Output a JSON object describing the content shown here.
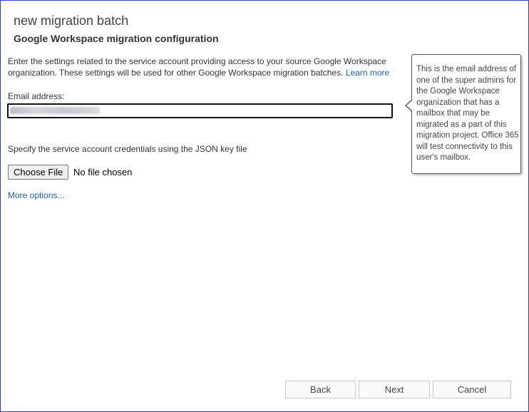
{
  "dialog": {
    "title": "new migration batch",
    "subtitle": "Google Workspace migration configuration"
  },
  "description": {
    "text": "Enter the settings related to the service account providing access to your source Google Workspace organization. These settings will be used for other Google Workspace migration batches.",
    "learn_more": "Learn more"
  },
  "email": {
    "label": "Email address:",
    "value": ""
  },
  "tooltip": {
    "text": "This is the email address of one of the super admins for the Google Workspace organization that has a mailbox that may be migrated as a part of this migration project. Office 365 will test connectivity to this user's mailbox."
  },
  "credentials": {
    "label": "Specify the service account credentials using the JSON key file",
    "choose_file": "Choose File",
    "file_status": "No file chosen"
  },
  "more_options": "More options...",
  "footer": {
    "back": "Back",
    "next": "Next",
    "cancel": "Cancel"
  }
}
